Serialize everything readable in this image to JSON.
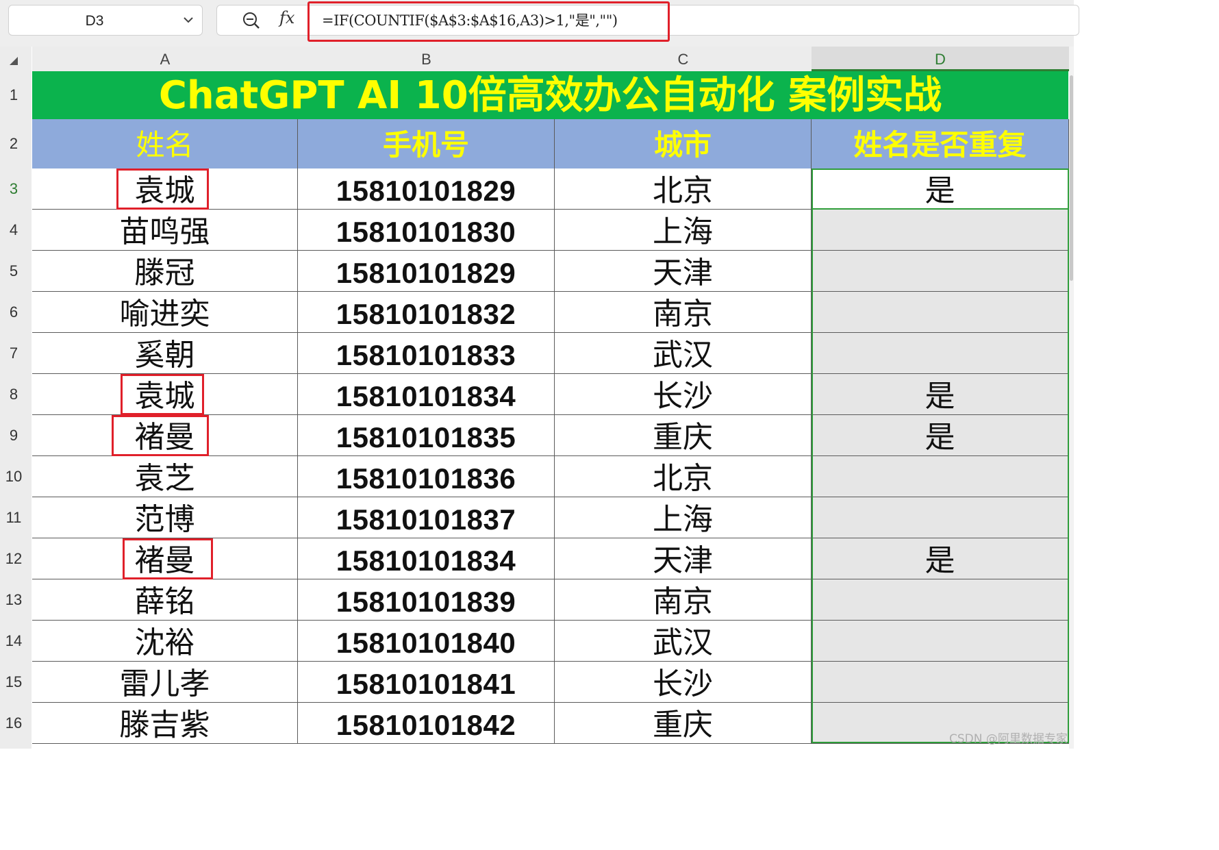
{
  "name_box": {
    "cell_ref": "D3"
  },
  "formula_bar": {
    "formula": "=IF(COUNTIF($A$3:$A$16,A3)>1,\"是\",\"\")",
    "fx_label": "fx"
  },
  "column_headers": [
    "A",
    "B",
    "C",
    "D"
  ],
  "row_numbers": [
    "1",
    "2",
    "3",
    "4",
    "5",
    "6",
    "7",
    "8",
    "9",
    "10",
    "11",
    "12",
    "13",
    "14",
    "15",
    "16"
  ],
  "title": "ChatGPT AI 10倍高效办公自动化 案例实战",
  "table": {
    "headers": [
      "姓名",
      "手机号",
      "城市",
      "姓名是否重复"
    ],
    "rows": [
      {
        "name": "袁城",
        "phone": "15810101829",
        "city": "北京",
        "dup": "是"
      },
      {
        "name": "苗鸣强",
        "phone": "15810101830",
        "city": "上海",
        "dup": ""
      },
      {
        "name": "滕冠",
        "phone": "15810101829",
        "city": "天津",
        "dup": ""
      },
      {
        "name": "喻进奕",
        "phone": "15810101832",
        "city": "南京",
        "dup": ""
      },
      {
        "name": "奚朝",
        "phone": "15810101833",
        "city": "武汉",
        "dup": ""
      },
      {
        "name": "袁城",
        "phone": "15810101834",
        "city": "长沙",
        "dup": "是"
      },
      {
        "name": "褚曼",
        "phone": "15810101835",
        "city": "重庆",
        "dup": "是"
      },
      {
        "name": "袁芝",
        "phone": "15810101836",
        "city": "北京",
        "dup": ""
      },
      {
        "name": "范博",
        "phone": "15810101837",
        "city": "上海",
        "dup": ""
      },
      {
        "name": "褚曼",
        "phone": "15810101834",
        "city": "天津",
        "dup": "是"
      },
      {
        "name": "薛铭",
        "phone": "15810101839",
        "city": "南京",
        "dup": ""
      },
      {
        "name": "沈裕",
        "phone": "15810101840",
        "city": "武汉",
        "dup": ""
      },
      {
        "name": "雷儿孝",
        "phone": "15810101841",
        "city": "长沙",
        "dup": ""
      },
      {
        "name": "滕吉紫",
        "phone": "15810101842",
        "city": "重庆",
        "dup": ""
      }
    ]
  },
  "colors": {
    "title_bg": "#0bb34d",
    "title_text": "#ffff00",
    "header_bg": "#8eaadb",
    "highlight_box": "#e0202a",
    "selection": "#2e9d3a"
  },
  "watermark": "CSDN @阿里数据专家"
}
